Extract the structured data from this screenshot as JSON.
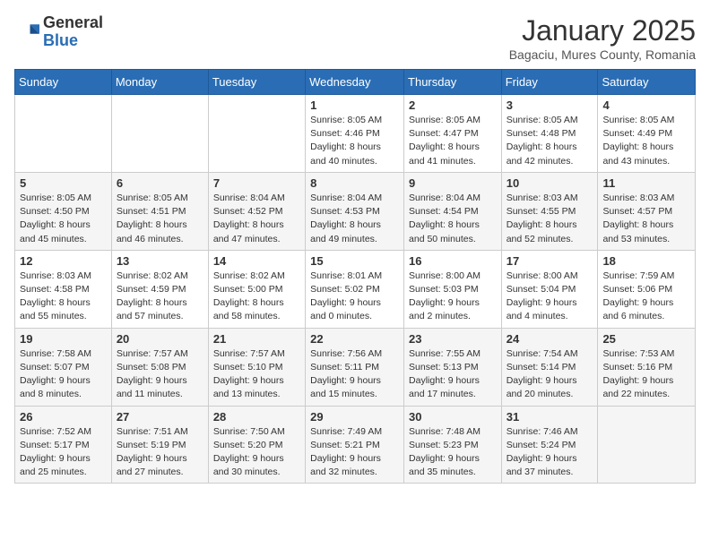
{
  "header": {
    "logo_general": "General",
    "logo_blue": "Blue",
    "month_title": "January 2025",
    "subtitle": "Bagaciu, Mures County, Romania"
  },
  "weekdays": [
    "Sunday",
    "Monday",
    "Tuesday",
    "Wednesday",
    "Thursday",
    "Friday",
    "Saturday"
  ],
  "weeks": [
    [
      {
        "day": "",
        "sunrise": "",
        "sunset": "",
        "daylight": ""
      },
      {
        "day": "",
        "sunrise": "",
        "sunset": "",
        "daylight": ""
      },
      {
        "day": "",
        "sunrise": "",
        "sunset": "",
        "daylight": ""
      },
      {
        "day": "1",
        "sunrise": "Sunrise: 8:05 AM",
        "sunset": "Sunset: 4:46 PM",
        "daylight": "Daylight: 8 hours and 40 minutes."
      },
      {
        "day": "2",
        "sunrise": "Sunrise: 8:05 AM",
        "sunset": "Sunset: 4:47 PM",
        "daylight": "Daylight: 8 hours and 41 minutes."
      },
      {
        "day": "3",
        "sunrise": "Sunrise: 8:05 AM",
        "sunset": "Sunset: 4:48 PM",
        "daylight": "Daylight: 8 hours and 42 minutes."
      },
      {
        "day": "4",
        "sunrise": "Sunrise: 8:05 AM",
        "sunset": "Sunset: 4:49 PM",
        "daylight": "Daylight: 8 hours and 43 minutes."
      }
    ],
    [
      {
        "day": "5",
        "sunrise": "Sunrise: 8:05 AM",
        "sunset": "Sunset: 4:50 PM",
        "daylight": "Daylight: 8 hours and 45 minutes."
      },
      {
        "day": "6",
        "sunrise": "Sunrise: 8:05 AM",
        "sunset": "Sunset: 4:51 PM",
        "daylight": "Daylight: 8 hours and 46 minutes."
      },
      {
        "day": "7",
        "sunrise": "Sunrise: 8:04 AM",
        "sunset": "Sunset: 4:52 PM",
        "daylight": "Daylight: 8 hours and 47 minutes."
      },
      {
        "day": "8",
        "sunrise": "Sunrise: 8:04 AM",
        "sunset": "Sunset: 4:53 PM",
        "daylight": "Daylight: 8 hours and 49 minutes."
      },
      {
        "day": "9",
        "sunrise": "Sunrise: 8:04 AM",
        "sunset": "Sunset: 4:54 PM",
        "daylight": "Daylight: 8 hours and 50 minutes."
      },
      {
        "day": "10",
        "sunrise": "Sunrise: 8:03 AM",
        "sunset": "Sunset: 4:55 PM",
        "daylight": "Daylight: 8 hours and 52 minutes."
      },
      {
        "day": "11",
        "sunrise": "Sunrise: 8:03 AM",
        "sunset": "Sunset: 4:57 PM",
        "daylight": "Daylight: 8 hours and 53 minutes."
      }
    ],
    [
      {
        "day": "12",
        "sunrise": "Sunrise: 8:03 AM",
        "sunset": "Sunset: 4:58 PM",
        "daylight": "Daylight: 8 hours and 55 minutes."
      },
      {
        "day": "13",
        "sunrise": "Sunrise: 8:02 AM",
        "sunset": "Sunset: 4:59 PM",
        "daylight": "Daylight: 8 hours and 57 minutes."
      },
      {
        "day": "14",
        "sunrise": "Sunrise: 8:02 AM",
        "sunset": "Sunset: 5:00 PM",
        "daylight": "Daylight: 8 hours and 58 minutes."
      },
      {
        "day": "15",
        "sunrise": "Sunrise: 8:01 AM",
        "sunset": "Sunset: 5:02 PM",
        "daylight": "Daylight: 9 hours and 0 minutes."
      },
      {
        "day": "16",
        "sunrise": "Sunrise: 8:00 AM",
        "sunset": "Sunset: 5:03 PM",
        "daylight": "Daylight: 9 hours and 2 minutes."
      },
      {
        "day": "17",
        "sunrise": "Sunrise: 8:00 AM",
        "sunset": "Sunset: 5:04 PM",
        "daylight": "Daylight: 9 hours and 4 minutes."
      },
      {
        "day": "18",
        "sunrise": "Sunrise: 7:59 AM",
        "sunset": "Sunset: 5:06 PM",
        "daylight": "Daylight: 9 hours and 6 minutes."
      }
    ],
    [
      {
        "day": "19",
        "sunrise": "Sunrise: 7:58 AM",
        "sunset": "Sunset: 5:07 PM",
        "daylight": "Daylight: 9 hours and 8 minutes."
      },
      {
        "day": "20",
        "sunrise": "Sunrise: 7:57 AM",
        "sunset": "Sunset: 5:08 PM",
        "daylight": "Daylight: 9 hours and 11 minutes."
      },
      {
        "day": "21",
        "sunrise": "Sunrise: 7:57 AM",
        "sunset": "Sunset: 5:10 PM",
        "daylight": "Daylight: 9 hours and 13 minutes."
      },
      {
        "day": "22",
        "sunrise": "Sunrise: 7:56 AM",
        "sunset": "Sunset: 5:11 PM",
        "daylight": "Daylight: 9 hours and 15 minutes."
      },
      {
        "day": "23",
        "sunrise": "Sunrise: 7:55 AM",
        "sunset": "Sunset: 5:13 PM",
        "daylight": "Daylight: 9 hours and 17 minutes."
      },
      {
        "day": "24",
        "sunrise": "Sunrise: 7:54 AM",
        "sunset": "Sunset: 5:14 PM",
        "daylight": "Daylight: 9 hours and 20 minutes."
      },
      {
        "day": "25",
        "sunrise": "Sunrise: 7:53 AM",
        "sunset": "Sunset: 5:16 PM",
        "daylight": "Daylight: 9 hours and 22 minutes."
      }
    ],
    [
      {
        "day": "26",
        "sunrise": "Sunrise: 7:52 AM",
        "sunset": "Sunset: 5:17 PM",
        "daylight": "Daylight: 9 hours and 25 minutes."
      },
      {
        "day": "27",
        "sunrise": "Sunrise: 7:51 AM",
        "sunset": "Sunset: 5:19 PM",
        "daylight": "Daylight: 9 hours and 27 minutes."
      },
      {
        "day": "28",
        "sunrise": "Sunrise: 7:50 AM",
        "sunset": "Sunset: 5:20 PM",
        "daylight": "Daylight: 9 hours and 30 minutes."
      },
      {
        "day": "29",
        "sunrise": "Sunrise: 7:49 AM",
        "sunset": "Sunset: 5:21 PM",
        "daylight": "Daylight: 9 hours and 32 minutes."
      },
      {
        "day": "30",
        "sunrise": "Sunrise: 7:48 AM",
        "sunset": "Sunset: 5:23 PM",
        "daylight": "Daylight: 9 hours and 35 minutes."
      },
      {
        "day": "31",
        "sunrise": "Sunrise: 7:46 AM",
        "sunset": "Sunset: 5:24 PM",
        "daylight": "Daylight: 9 hours and 37 minutes."
      },
      {
        "day": "",
        "sunrise": "",
        "sunset": "",
        "daylight": ""
      }
    ]
  ]
}
